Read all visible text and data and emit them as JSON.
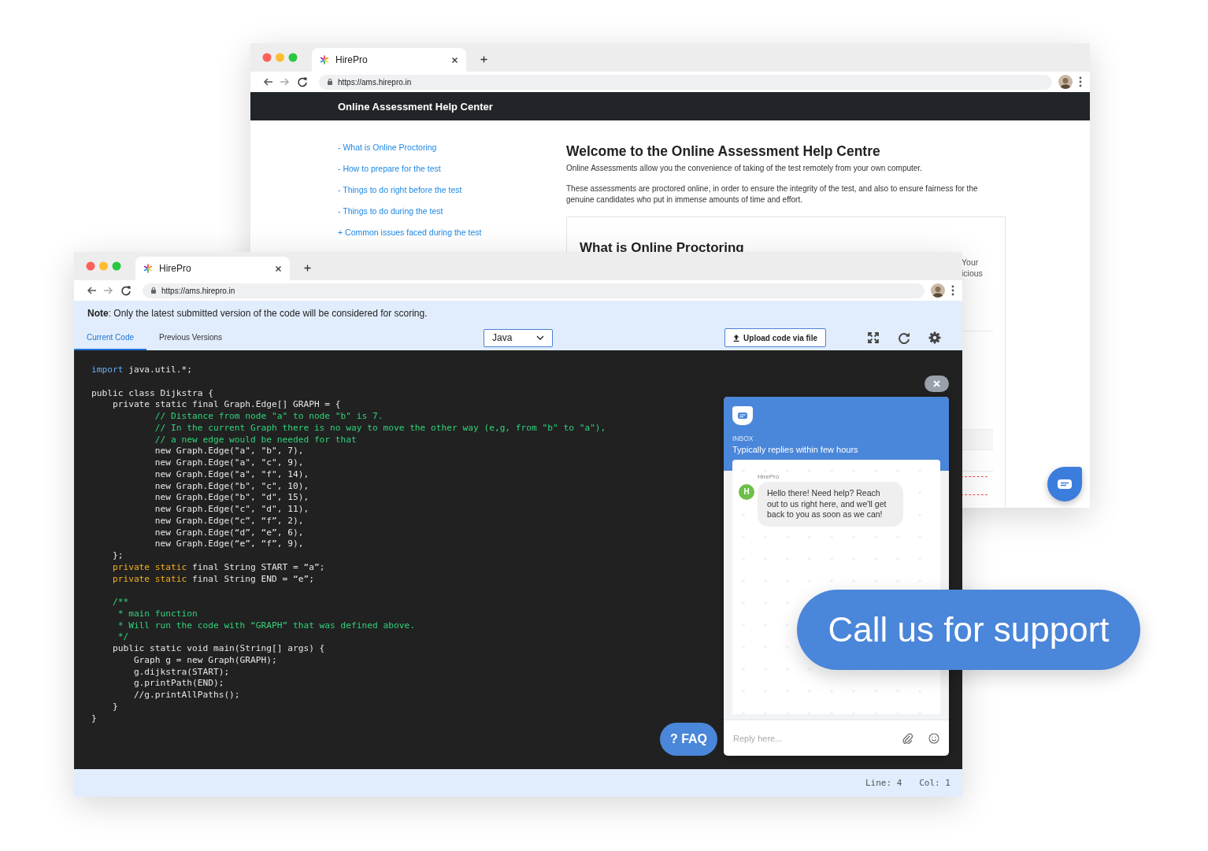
{
  "back_window": {
    "tab_title": "HirePro",
    "url": "https://ams.hirepro.in",
    "header_title": "Online Assessment Help Center",
    "nav_links": [
      "- What is Online Proctoring",
      "- How to prepare for the test",
      "- Things to do right before the test",
      "- Things to do during the test",
      "+ Common issues faced during the test"
    ],
    "heading": "Welcome to the Online Assessment Help Centre",
    "paragraphs": [
      "Online Assessments allow you the convenience of taking of the test remotely from your own computer.",
      "These assessments are proctored online, in order to ensure the integrity of the test, and also to ensure fairness for the genuine candidates who put in immense amounts of time and effort."
    ],
    "card": {
      "heading": "What is Online Proctoring",
      "text_lines": [
        "Your",
        "icious"
      ]
    }
  },
  "front_window": {
    "tab_title": "HirePro",
    "url": "https://ams.hirepro.in",
    "note": "**Note**: Only the latest submitted version of the code will be considered for scoring.",
    "tabs": [
      {
        "label": "Current Code",
        "selected": true
      },
      {
        "label": "Previous Versions",
        "selected": false
      }
    ],
    "language": "Java",
    "upload_button": "Upload code via file",
    "code_lines": [
      {
        "kind": "code",
        "segments": [
          {
            "kind": "keyword",
            "text": "import"
          },
          {
            "kind": "plain",
            "text": " java.util.*;"
          }
        ]
      },
      {
        "kind": "blank"
      },
      {
        "kind": "code",
        "segments": [
          {
            "kind": "plain",
            "text": "public class Dijkstra {"
          }
        ]
      },
      {
        "kind": "code",
        "segments": [
          {
            "kind": "plain",
            "text": "    private static final Graph.Edge[] GRAPH = {"
          }
        ]
      },
      {
        "kind": "code",
        "segments": [
          {
            "kind": "comment",
            "text": "            // Distance from node \"a\" to node \"b\" is 7."
          }
        ]
      },
      {
        "kind": "code",
        "segments": [
          {
            "kind": "comment",
            "text": "            // In the current Graph there is no way to move the other way (e,g, from \"b\" to \"a\"),"
          }
        ]
      },
      {
        "kind": "code",
        "segments": [
          {
            "kind": "comment",
            "text": "            // a new edge would be needed for that"
          }
        ]
      },
      {
        "kind": "code",
        "segments": [
          {
            "kind": "plain",
            "text": "            new Graph.Edge(\"a\", \"b\", 7),"
          }
        ]
      },
      {
        "kind": "code",
        "segments": [
          {
            "kind": "plain",
            "text": "            new Graph.Edge(\"a\", \"c\", 9),"
          }
        ]
      },
      {
        "kind": "code",
        "segments": [
          {
            "kind": "plain",
            "text": "            new Graph.Edge(\"a\", \"f\", 14),"
          }
        ]
      },
      {
        "kind": "code",
        "segments": [
          {
            "kind": "plain",
            "text": "            new Graph.Edge(\"b\", \"c\", 10),"
          }
        ]
      },
      {
        "kind": "code",
        "segments": [
          {
            "kind": "plain",
            "text": "            new Graph.Edge(\"b\", \"d\", 15),"
          }
        ]
      },
      {
        "kind": "code",
        "segments": [
          {
            "kind": "plain",
            "text": "            new Graph.Edge(\"c\", \"d\", 11),"
          }
        ]
      },
      {
        "kind": "code",
        "segments": [
          {
            "kind": "plain",
            "text": "            new Graph.Edge(“c”, “f”, 2),"
          }
        ]
      },
      {
        "kind": "code",
        "segments": [
          {
            "kind": "plain",
            "text": "            new Graph.Edge(“d”, “e”, 6),"
          }
        ]
      },
      {
        "kind": "code",
        "segments": [
          {
            "kind": "plain",
            "text": "            new Graph.Edge(“e”, “f”, 9),"
          }
        ]
      },
      {
        "kind": "code",
        "segments": [
          {
            "kind": "plain",
            "text": "    };"
          }
        ]
      },
      {
        "kind": "code",
        "segments": [
          {
            "kind": "modifier",
            "text": "    private static"
          },
          {
            "kind": "plain",
            "text": " final String START = “a”;"
          }
        ]
      },
      {
        "kind": "code",
        "segments": [
          {
            "kind": "modifier",
            "text": "    private static"
          },
          {
            "kind": "plain",
            "text": " final String END = “e”;"
          }
        ]
      },
      {
        "kind": "blank"
      },
      {
        "kind": "code",
        "segments": [
          {
            "kind": "comment",
            "text": "    /**"
          }
        ]
      },
      {
        "kind": "code",
        "segments": [
          {
            "kind": "comment",
            "text": "     * main function"
          }
        ]
      },
      {
        "kind": "code",
        "segments": [
          {
            "kind": "comment",
            "text": "     * Will run the code with “GRAPH” that was defined above."
          }
        ]
      },
      {
        "kind": "code",
        "segments": [
          {
            "kind": "comment",
            "text": "     */"
          }
        ]
      },
      {
        "kind": "code",
        "segments": [
          {
            "kind": "plain",
            "text": "    public static void main(String[] args) {"
          }
        ]
      },
      {
        "kind": "code",
        "segments": [
          {
            "kind": "plain",
            "text": "        Graph g = new Graph(GRAPH);"
          }
        ]
      },
      {
        "kind": "code",
        "segments": [
          {
            "kind": "plain",
            "text": "        g.dijkstra(START);"
          }
        ]
      },
      {
        "kind": "code",
        "segments": [
          {
            "kind": "plain",
            "text": "        g.printPath(END);"
          }
        ]
      },
      {
        "kind": "code",
        "segments": [
          {
            "kind": "plain",
            "text": "        //g.printAllPaths();"
          }
        ]
      },
      {
        "kind": "code",
        "segments": [
          {
            "kind": "plain",
            "text": "    }"
          }
        ]
      },
      {
        "kind": "code",
        "segments": [
          {
            "kind": "plain",
            "text": "}"
          }
        ]
      }
    ],
    "faq_button": "? FAQ",
    "chat": {
      "inbox_label": "INBOX",
      "subtitle": "Typically replies within few hours",
      "sender": "HirePro",
      "avatar_letter": "H",
      "message": "Hello there! Need help? Reach out to us right here, and we'll get back to you as soon as we can!",
      "reply_placeholder": "Reply here..."
    },
    "status": {
      "line": "Line: 4",
      "col": "Col: 1"
    }
  },
  "callout": "Call us for support"
}
